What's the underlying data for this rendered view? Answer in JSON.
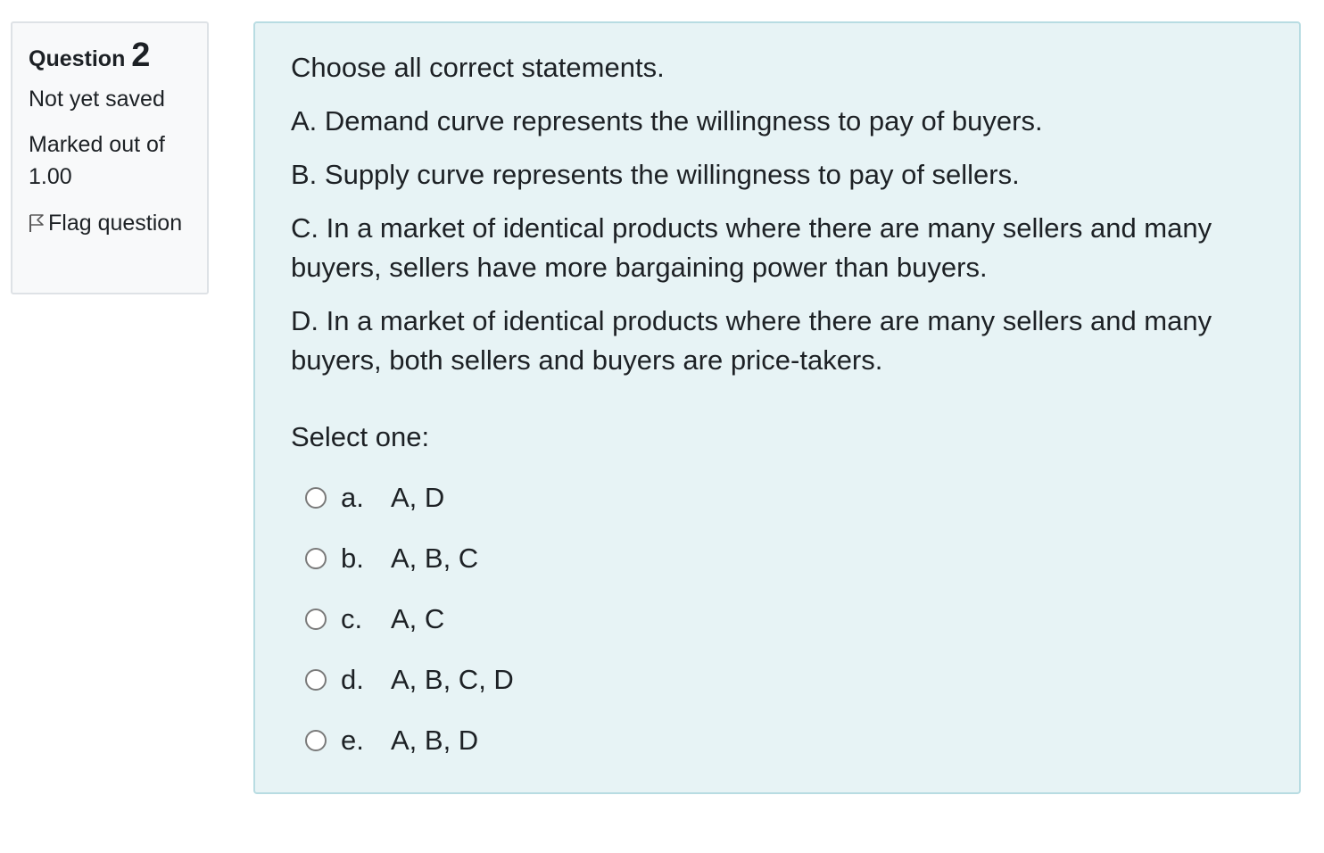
{
  "info": {
    "question_word": "Question",
    "question_number": "2",
    "state": "Not yet saved",
    "grade": "Marked out of 1.00",
    "flag_label": "Flag question",
    "flag_icon": "flag-icon"
  },
  "question": {
    "paragraphs": [
      "Choose all correct statements.",
      "A. Demand curve represents the willingness to pay of buyers.",
      "B. Supply curve represents the willingness to pay of sellers.",
      "C. In a market of identical products where there are many sellers and many buyers, sellers have more bargaining power than buyers.",
      "D. In a market of identical products where there are many sellers and many buyers, both sellers and buyers are price-takers."
    ],
    "prompt": "Select one:",
    "options": [
      {
        "letter": "a.",
        "text": "A, D"
      },
      {
        "letter": "b.",
        "text": "A, B, C"
      },
      {
        "letter": "c.",
        "text": "A, C"
      },
      {
        "letter": "d.",
        "text": "A, B, C, D"
      },
      {
        "letter": "e.",
        "text": "A, B, D"
      }
    ]
  },
  "colors": {
    "info_bg": "#f8f9fa",
    "content_bg": "#e7f3f5",
    "content_border": "#b8dce2",
    "text": "#1d2125"
  }
}
